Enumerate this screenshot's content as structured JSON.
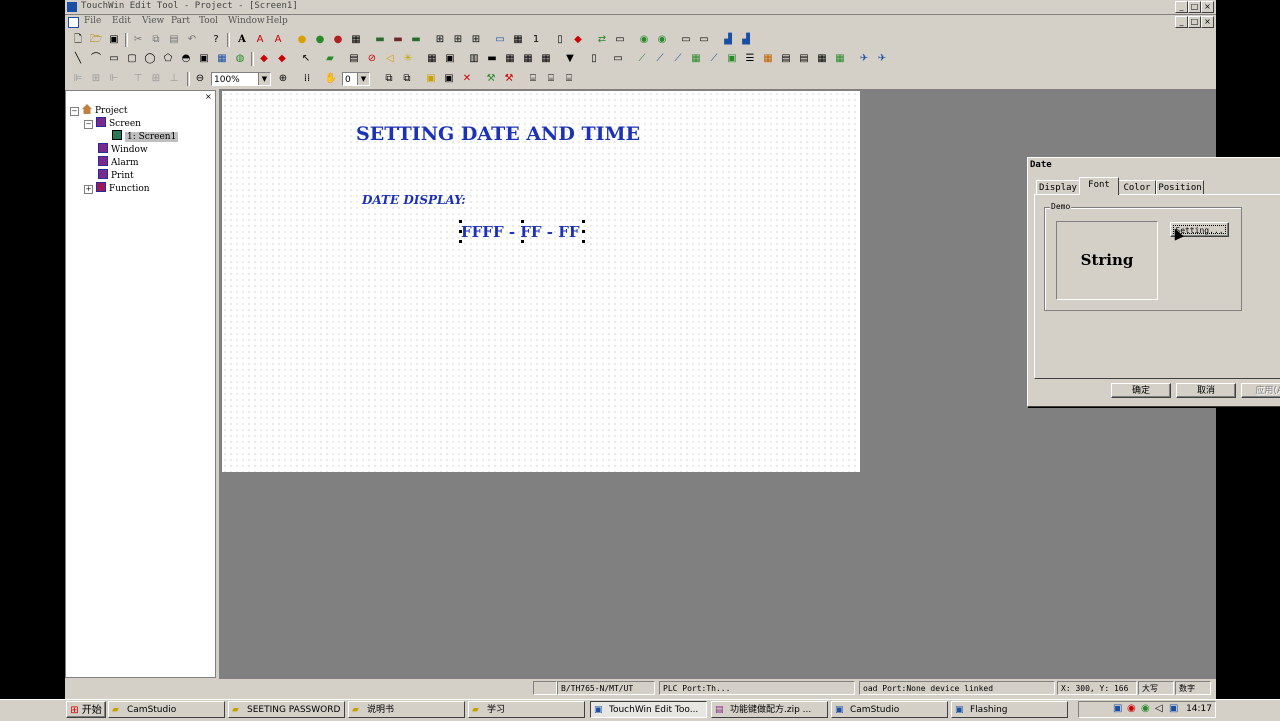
{
  "titlebar": {
    "title": "TouchWin Edit Tool - Project - [Screen1]",
    "min": "_",
    "max": "□",
    "close": "×"
  },
  "menu": {
    "items": [
      "File",
      "Edit",
      "View",
      "Part",
      "Tool",
      "Window",
      "Help"
    ]
  },
  "toolbar": {
    "zoom": "100%",
    "layer": "0"
  },
  "tree": {
    "close": "×",
    "root": "Project",
    "screen": "Screen",
    "screen1": "1: Screen1",
    "window": "Window",
    "alarm": "Alarm",
    "print": "Print",
    "function": "Function",
    "expand_minus": "−",
    "expand_plus": "+"
  },
  "canvas": {
    "title": "SETTING DATE AND TIME",
    "date_label": "DATE DISPLAY:",
    "date_value": "FFFF - FF - FF"
  },
  "dialog": {
    "title": "Date",
    "close": "×",
    "tabs": [
      "Display",
      "Font",
      "Color",
      "Position"
    ],
    "active_tab": "Font",
    "group_label": "Demo",
    "demo_text": "String",
    "setting_button": "Setting...",
    "ok_button": "确定",
    "cancel_button": "取消",
    "apply_button": "应用(A)"
  },
  "statusbar": {
    "model": "B/TH765-N/MT/UT",
    "plc_port": "PLC Port:Th...",
    "download_port": "oad Port:None device linked",
    "coords": "X: 300, Y: 166",
    "caps": "大写",
    "num": "数字"
  },
  "taskbar": {
    "start": "开始",
    "tasks": [
      "CamStudio",
      "SEETING PASSWORD ...",
      "说明书",
      "学习",
      "TouchWin Edit Too...",
      "功能键做配方.zip ...",
      "CamStudio",
      "Flashing"
    ],
    "clock": "14:17"
  },
  "colors": {
    "canvas_text": "#1c32b5",
    "chrome": "#d4d0c8",
    "workspace": "#808080"
  }
}
